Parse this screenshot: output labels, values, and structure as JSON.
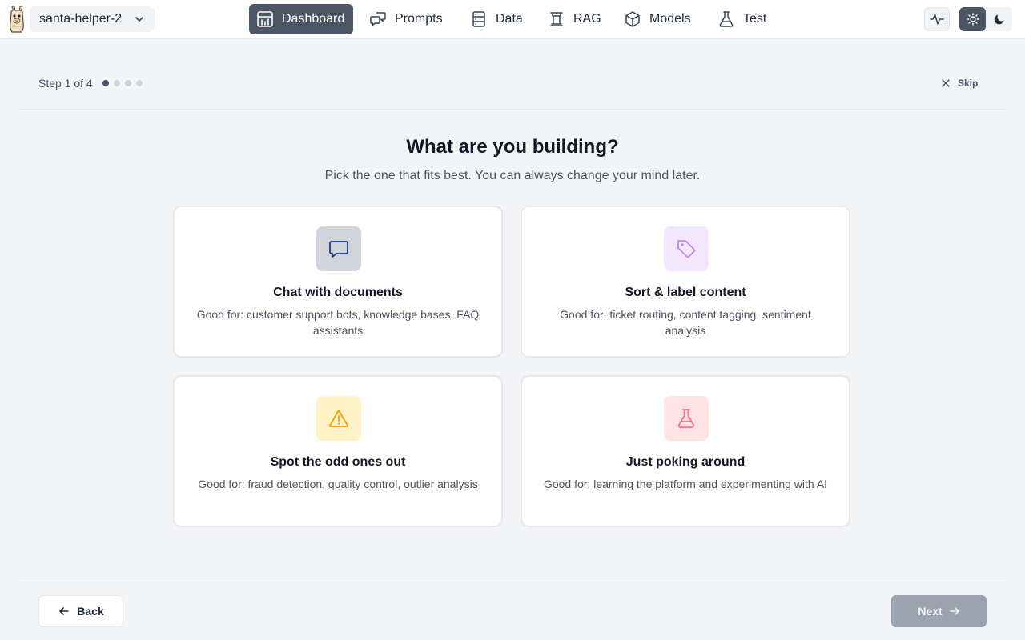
{
  "app": {
    "logo_icon": "llama-logo-icon",
    "project_name": "santa-helper-2"
  },
  "nav": {
    "items": [
      {
        "label": "Dashboard",
        "icon": "dashboard-icon",
        "active": true
      },
      {
        "label": "Prompts",
        "icon": "chat-bubbles-icon",
        "active": false
      },
      {
        "label": "Data",
        "icon": "database-icon",
        "active": false
      },
      {
        "label": "RAG",
        "icon": "rag-tower-icon",
        "active": false
      },
      {
        "label": "Models",
        "icon": "cube-icon",
        "active": false
      },
      {
        "label": "Test",
        "icon": "flask-icon",
        "active": false
      }
    ]
  },
  "toolbar": {
    "activity_icon": "activity-icon",
    "theme": {
      "selected": "light",
      "light_icon": "sun-icon",
      "dark_icon": "moon-icon"
    }
  },
  "stepper": {
    "label": "Step 1 of 4",
    "current": 1,
    "total": 4,
    "skip_label": "Skip"
  },
  "main": {
    "title": "What are you building?",
    "subtitle": "Pick the one that fits best. You can always change your mind later.",
    "options": [
      {
        "title": "Chat with documents",
        "description": "Good for: customer support bots, knowledge bases, FAQ assistants",
        "icon": "chat-icon",
        "icon_bg": "#d1d5db",
        "icon_color": "#1e3a8a"
      },
      {
        "title": "Sort & label content",
        "description": "Good for: ticket routing, content tagging, sentiment analysis",
        "icon": "tag-icon",
        "icon_bg": "#f3e8ff",
        "icon_color": "#c084fc"
      },
      {
        "title": "Spot the odd ones out",
        "description": "Good for: fraud detection, quality control, outlier analysis",
        "icon": "warning-icon",
        "icon_bg": "#fef3c7",
        "icon_color": "#f59e0b"
      },
      {
        "title": "Just poking around",
        "description": "Good for: learning the platform and experimenting with AI",
        "icon": "flask-icon",
        "icon_bg": "#ffe4e6",
        "icon_color": "#fb7185"
      }
    ]
  },
  "footer": {
    "back_label": "Back",
    "next_label": "Next",
    "next_enabled": false
  }
}
